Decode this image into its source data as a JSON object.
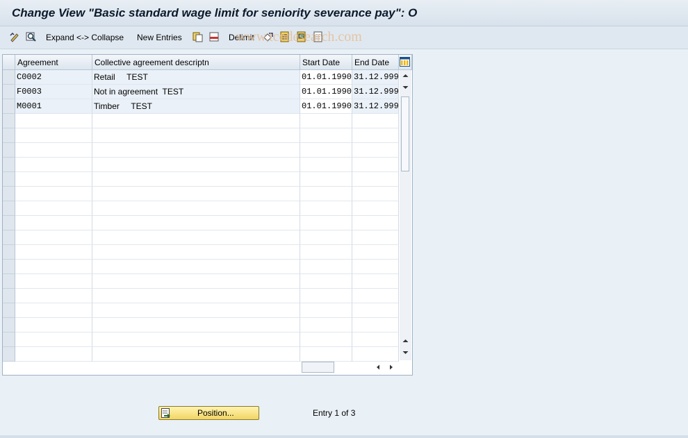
{
  "window": {
    "title": "Change View \"Basic standard wage limit for seniority severance pay\": O"
  },
  "toolbar": {
    "expand_collapse_label": "Expand <-> Collapse",
    "new_entries_label": "New Entries",
    "delimit_label": "Delimit"
  },
  "watermark": "www.tcodesearch.com",
  "table": {
    "columns": [
      "Agreement",
      "Collective agreement descriptn",
      "Start Date",
      "End Date"
    ],
    "rows": [
      {
        "agreement": "C0002",
        "description": "Retail     TEST",
        "start": "01.01.1990",
        "end": "31.12.999"
      },
      {
        "agreement": "F0003",
        "description": "Not in agreement  TEST",
        "start": "01.01.1990",
        "end": "31.12.999"
      },
      {
        "agreement": "M0001",
        "description": "Timber     TEST",
        "start": "01.01.1990",
        "end": "31.12.999"
      }
    ]
  },
  "footer": {
    "position_button_label": "Position...",
    "entry_text": "Entry 1 of 3"
  },
  "colors": {
    "accent_button": "#f2d564",
    "header_bg": "#dce5ee",
    "row_highlight": "#eaf1f8"
  }
}
